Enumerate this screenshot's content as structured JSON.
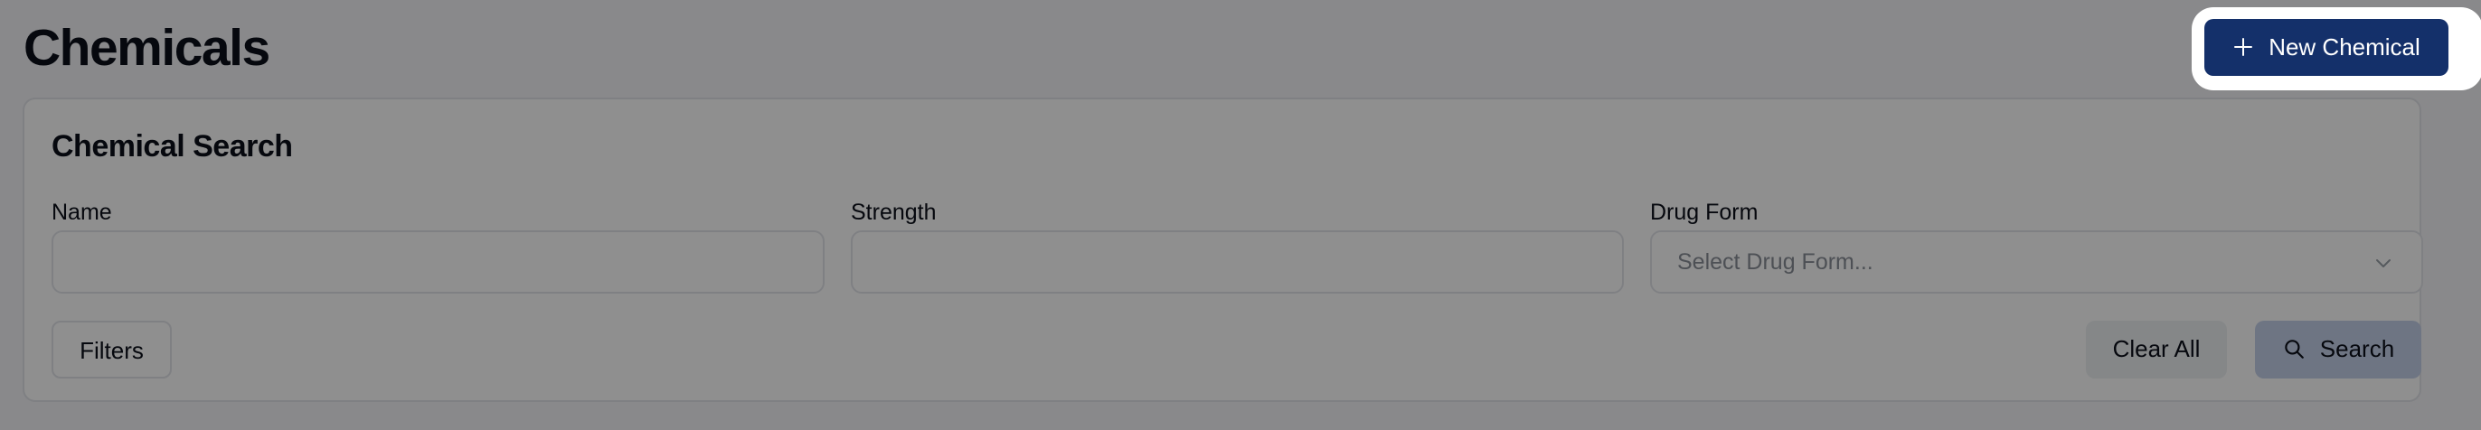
{
  "page": {
    "title": "Chemicals"
  },
  "header": {
    "new_chemical_label": "New Chemical",
    "new_chemical_icon": "plus-icon"
  },
  "search_card": {
    "title": "Chemical Search",
    "fields": {
      "name": {
        "label": "Name",
        "value": "",
        "placeholder": ""
      },
      "strength": {
        "label": "Strength",
        "value": "",
        "placeholder": ""
      },
      "drug_form": {
        "label": "Drug Form",
        "placeholder": "Select Drug Form...",
        "icon": "chevron-down-icon"
      }
    },
    "buttons": {
      "filters": "Filters",
      "clear_all": "Clear All",
      "search": "Search",
      "search_icon": "search-icon"
    }
  },
  "colors": {
    "primary": "#14306a",
    "search_button_bg": "#c5d1ea",
    "overlay": "rgba(0,0,0,0.44)"
  }
}
